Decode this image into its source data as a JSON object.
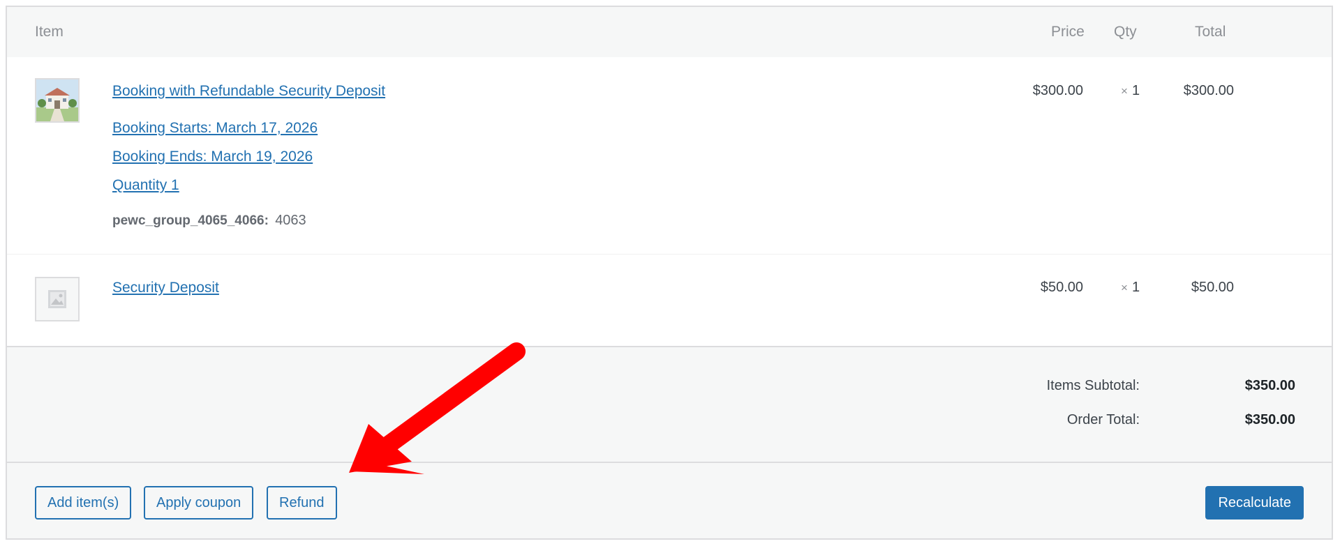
{
  "header": {
    "item": "Item",
    "price": "Price",
    "qty": "Qty",
    "total": "Total"
  },
  "items": [
    {
      "name": "Booking with Refundable Security Deposit",
      "meta_links": [
        "Booking Starts: March 17, 2026",
        "Booking Ends: March 19, 2026",
        "Quantity 1"
      ],
      "meta_key": "pewc_group_4065_4066:",
      "meta_value": "4063",
      "price": "$300.00",
      "qty_x": "×",
      "qty": "1",
      "total": "$300.00"
    },
    {
      "name": "Security Deposit",
      "price": "$50.00",
      "qty_x": "×",
      "qty": "1",
      "total": "$50.00"
    }
  ],
  "totals": {
    "subtotal_label": "Items Subtotal:",
    "subtotal_value": "$350.00",
    "order_total_label": "Order Total:",
    "order_total_value": "$350.00"
  },
  "actions": {
    "add_items": "Add item(s)",
    "apply_coupon": "Apply coupon",
    "refund": "Refund",
    "recalculate": "Recalculate"
  },
  "colors": {
    "link": "#2271b1",
    "primary_button": "#2271b1",
    "annotation_arrow": "#ff0000"
  }
}
